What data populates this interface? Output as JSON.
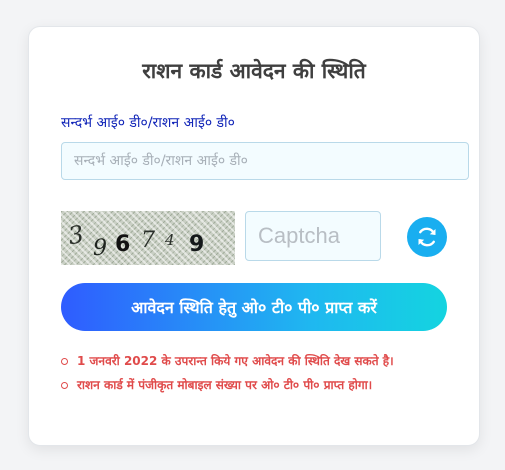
{
  "form": {
    "title": "राशन कार्ड आवेदन की स्थिति",
    "ref_label": "सन्दर्भ आई० डी०/राशन आई० डी०",
    "ref_placeholder": "सन्दर्भ आई० डी०/राशन आई० डी०",
    "ref_value": ""
  },
  "captcha": {
    "image_text": "396749",
    "input_placeholder": "Captcha",
    "refresh_icon": "refresh-icon"
  },
  "submit": {
    "label": "आवेदन स्थिति हेतु ओ० टी० पी० प्राप्त करें"
  },
  "notes": [
    "1 जनवरी 2022 के उपरान्त किये गए आवेदन की स्थिति देख सकते है।",
    "राशन कार्ड में पंजीकृत मोबाइल संख्या पर ओ० टी० पी० प्राप्त होगा।"
  ],
  "colors": {
    "title": "#3f3f3f",
    "label": "#1226b8",
    "note": "#e04b4b",
    "refresh": "#19aef0",
    "button_gradient_start": "#2f5cff",
    "button_gradient_end": "#14d4e0"
  }
}
